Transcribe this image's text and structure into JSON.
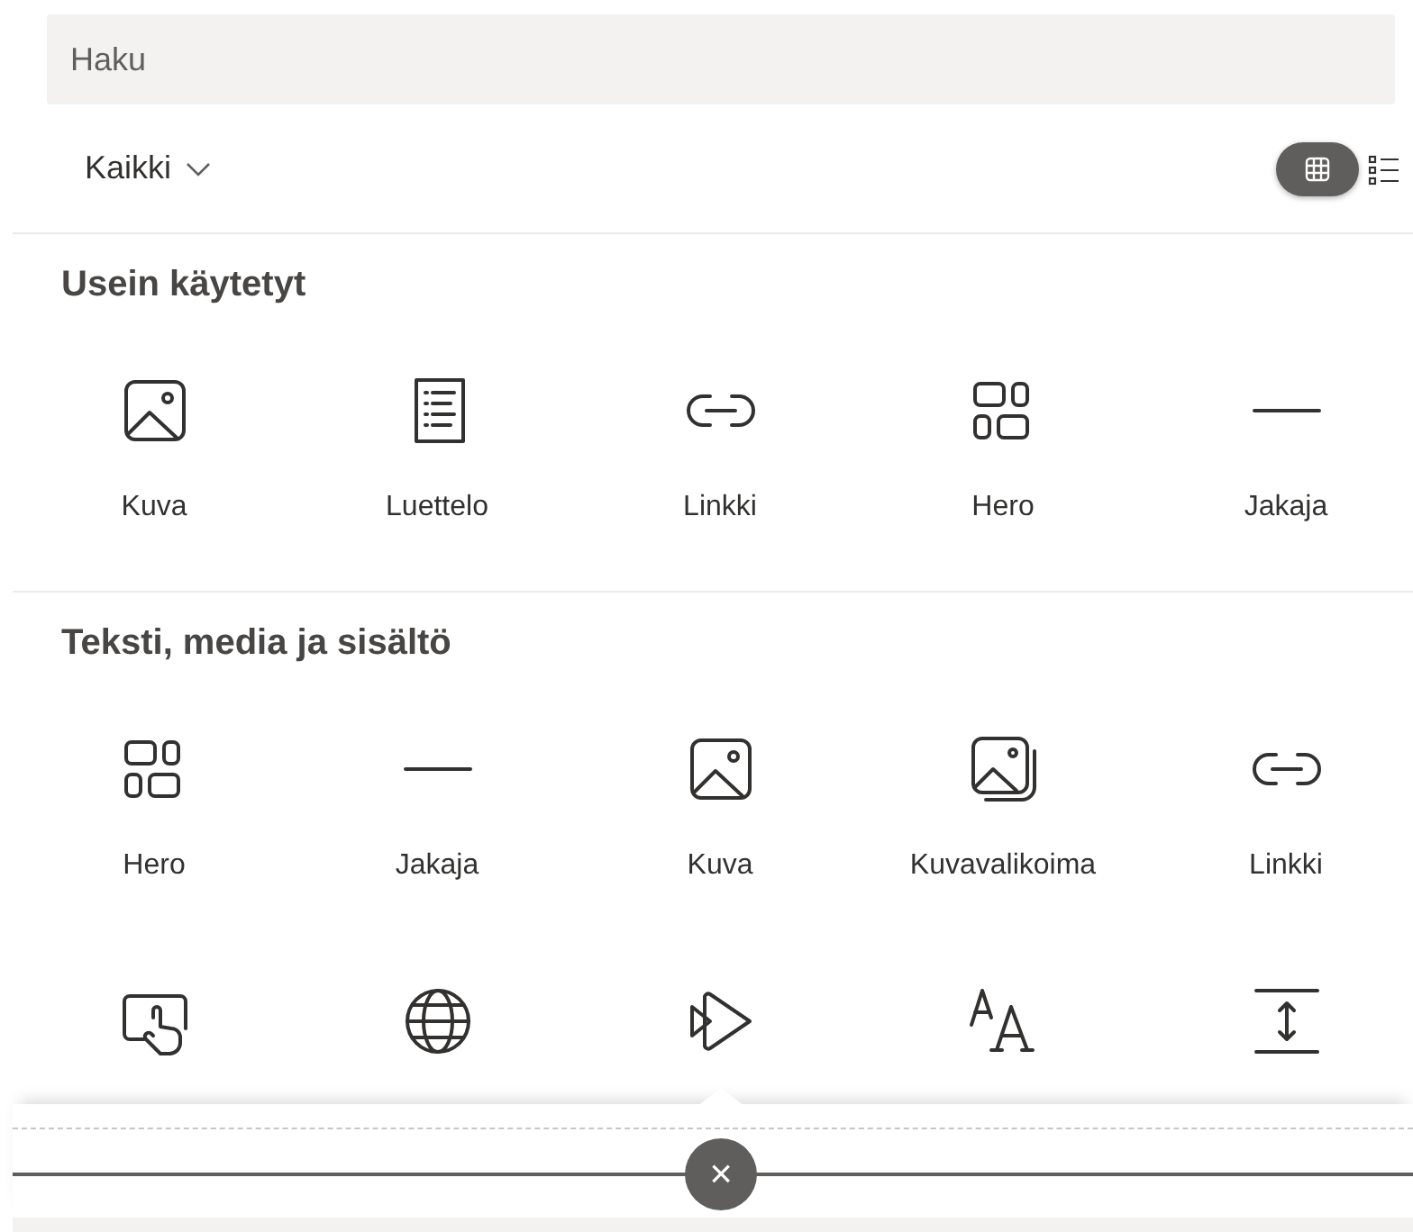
{
  "search": {
    "placeholder": "Haku"
  },
  "filter": {
    "label": "Kaikki"
  },
  "view_toggle": [
    {
      "kind": "grid",
      "selected": true
    },
    {
      "kind": "list",
      "selected": false
    }
  ],
  "sections": [
    {
      "title": "Usein käytetyt",
      "items": [
        {
          "kind": "image",
          "label": "Kuva"
        },
        {
          "kind": "list",
          "label": "Luettelo"
        },
        {
          "kind": "link",
          "label": "Linkki"
        },
        {
          "kind": "hero",
          "label": "Hero"
        },
        {
          "kind": "divider",
          "label": "Jakaja"
        }
      ]
    },
    {
      "title": "Teksti, media ja sisältö",
      "items": [
        {
          "kind": "hero",
          "label": "Hero"
        },
        {
          "kind": "divider",
          "label": "Jakaja"
        },
        {
          "kind": "image",
          "label": "Kuva"
        },
        {
          "kind": "gallery",
          "label": "Kuvavalikoima"
        },
        {
          "kind": "link",
          "label": "Linkki"
        },
        {
          "kind": "touch"
        },
        {
          "kind": "globe"
        },
        {
          "kind": "play"
        },
        {
          "kind": "font"
        },
        {
          "kind": "spacer"
        }
      ]
    }
  ],
  "close_button": {
    "label": "×"
  }
}
